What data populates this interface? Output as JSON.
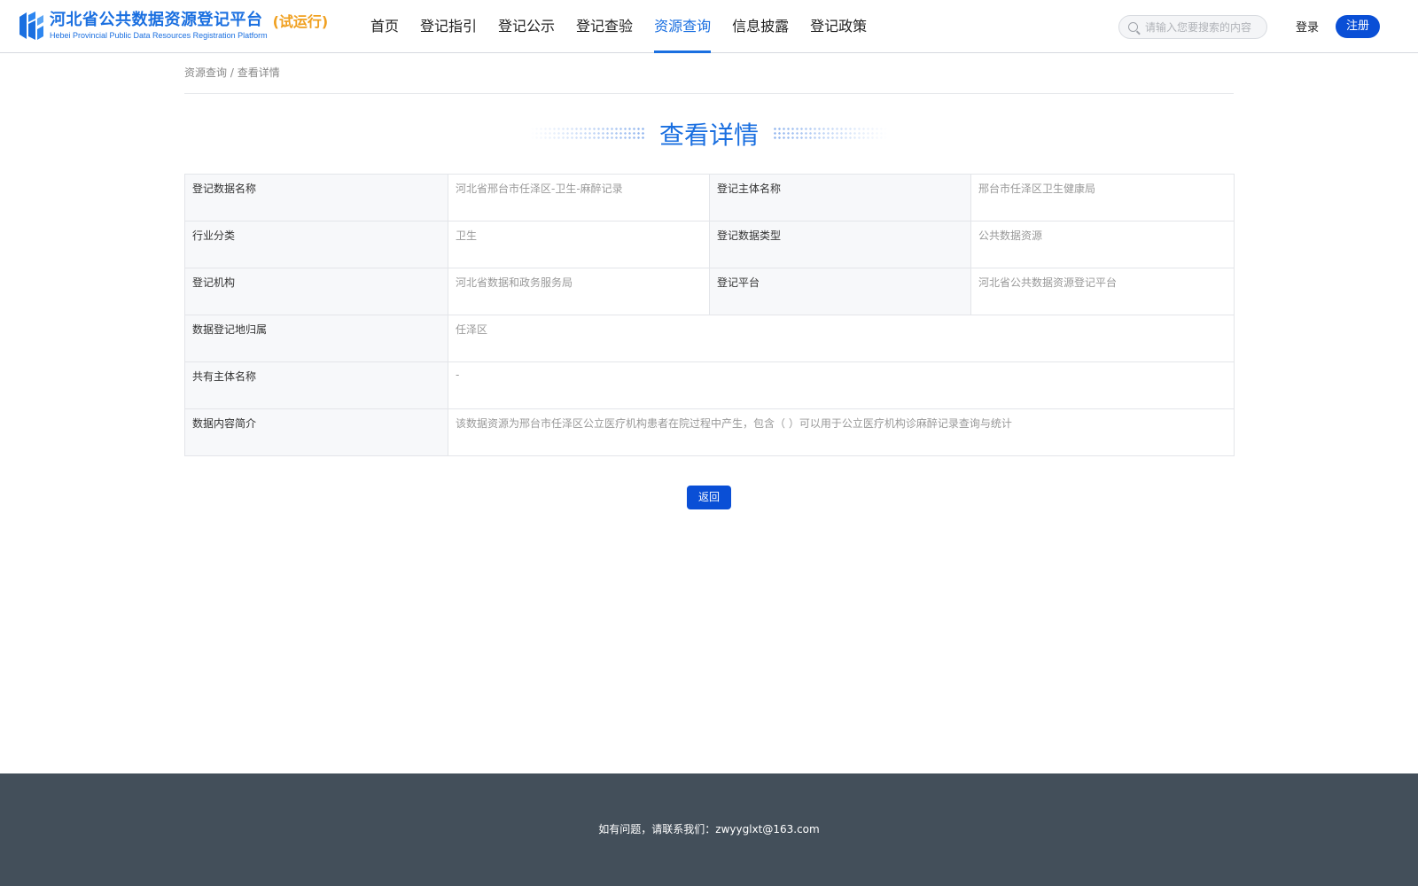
{
  "header": {
    "logo_cn": "河北省公共数据资源登记平台",
    "logo_en": "Hebei Provincial Public Data Resources Registration Platform",
    "logo_trial": "(试运行)",
    "nav": [
      {
        "label": "首页"
      },
      {
        "label": "登记指引"
      },
      {
        "label": "登记公示"
      },
      {
        "label": "登记查验"
      },
      {
        "label": "资源查询",
        "active": true
      },
      {
        "label": "信息披露"
      },
      {
        "label": "登记政策"
      }
    ],
    "search_placeholder": "请输入您要搜索的内容",
    "login_label": "登录",
    "register_label": "注册",
    "accent_color": "#1a6fe0",
    "button_color": "#0a4fd6"
  },
  "breadcrumb": {
    "parent": "资源查询",
    "separator": "/",
    "current": "查看详情"
  },
  "page_title": "查看详情",
  "details": {
    "registration_data_name_label": "登记数据名称",
    "registration_data_name_value": "河北省邢台市任泽区-卫生-麻醉记录",
    "registration_subject_label": "登记主体名称",
    "registration_subject_value": "邢台市任泽区卫生健康局",
    "industry_label": "行业分类",
    "industry_value": "卫生",
    "data_type_label": "登记数据类型",
    "data_type_value": "公共数据资源",
    "agency_label": "登记机构",
    "agency_value": "河北省数据和政务服务局",
    "platform_label": "登记平台",
    "platform_value": "河北省公共数据资源登记平台",
    "location_label": "数据登记地归属",
    "location_value": "任泽区",
    "co_owner_label": "共有主体名称",
    "co_owner_value": "-",
    "summary_label": "数据内容简介",
    "summary_value": "该数据资源为邢台市任泽区公立医疗机构患者在院过程中产生，包含（ ）可以用于公立医疗机构诊麻醉记录查询与统计"
  },
  "back_label": "返回",
  "footer": {
    "contact": "如有问题，请联系我们：zwyyglxt@163.com"
  }
}
